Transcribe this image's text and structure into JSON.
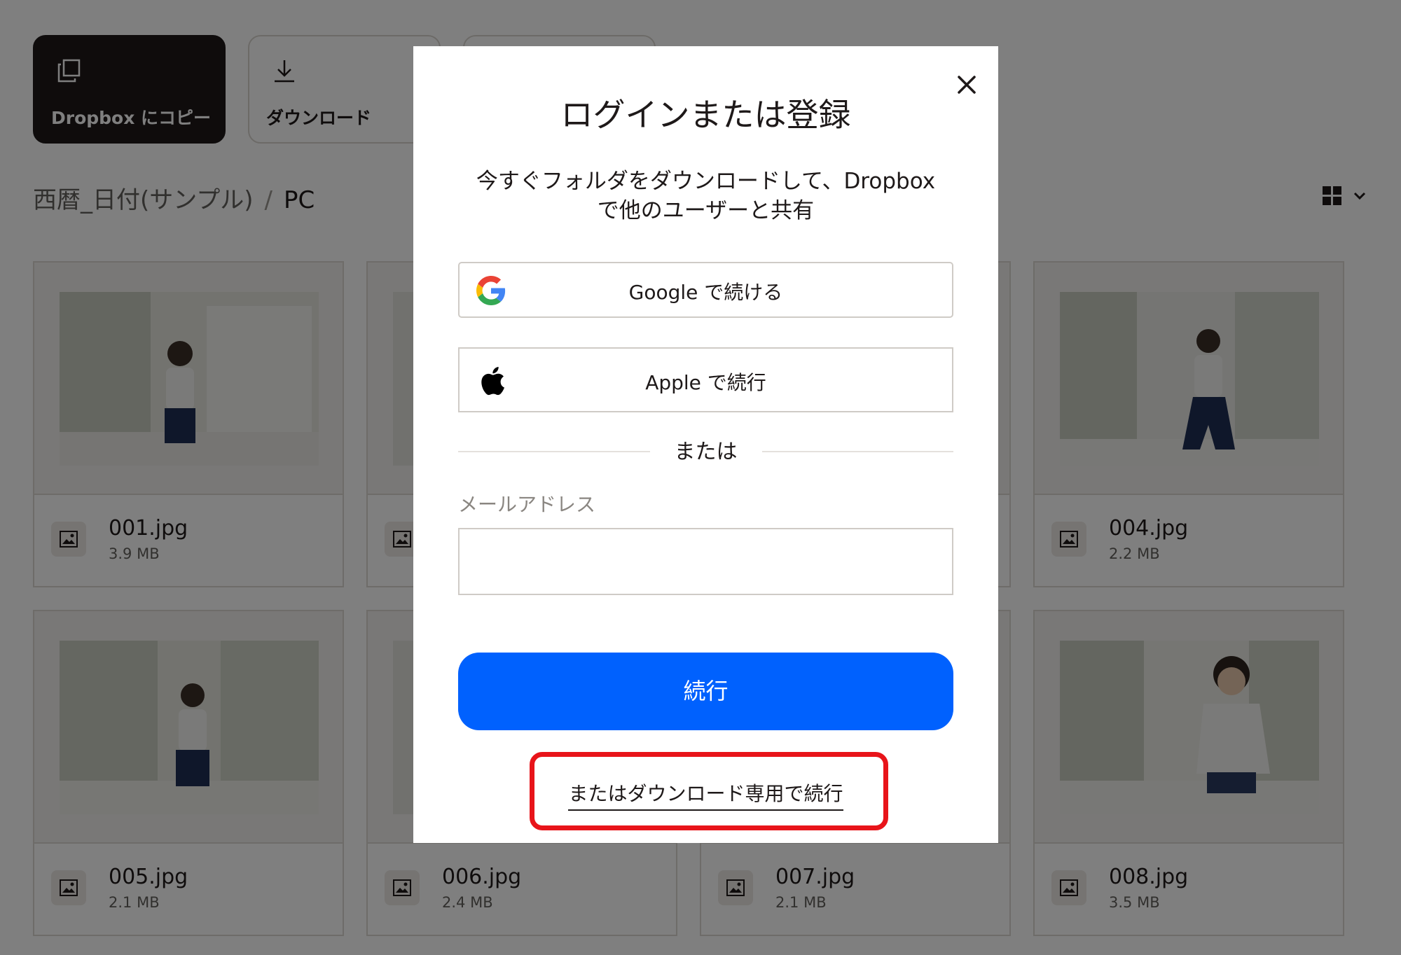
{
  "toolbar": {
    "copy_to_dropbox": "Dropbox にコピー",
    "download": "ダウンロード"
  },
  "breadcrumb": {
    "parent": "西暦_日付(サンプル)",
    "separator": "/",
    "current": "PC"
  },
  "files": [
    {
      "name": "001.jpg",
      "size": "3.9 MB"
    },
    {
      "name": "004.jpg",
      "size": "2.2 MB"
    },
    {
      "name": "005.jpg",
      "size": "2.1 MB"
    },
    {
      "name": "006.jpg",
      "size": "2.4 MB"
    },
    {
      "name": "007.jpg",
      "size": "2.1 MB"
    },
    {
      "name": "008.jpg",
      "size": "3.5 MB"
    }
  ],
  "modal": {
    "title": "ログインまたは登録",
    "subtitle": "今すぐフォルダをダウンロードして、Dropbox で他のユーザーと共有",
    "google_label": "Google で続ける",
    "apple_label": "Apple で続行",
    "divider": "または",
    "email_label": "メールアドレス",
    "email_value": "",
    "continue_label": "続行",
    "download_only_label": "またはダウンロード専用で続行"
  },
  "colors": {
    "primary_button": "#0061fe",
    "highlight_border": "#e8141a",
    "overlay": "rgba(0,0,0,0.5)"
  },
  "icons": {
    "copy": "copy-icon",
    "download": "download-icon",
    "grid_view": "grid-view-icon",
    "image_file": "image-file-icon",
    "close": "close-icon",
    "google": "google-logo-icon",
    "apple": "apple-logo-icon"
  }
}
